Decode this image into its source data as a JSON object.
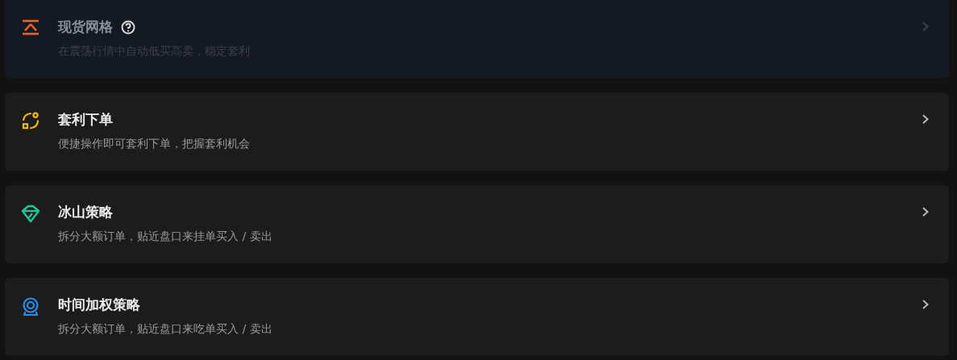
{
  "strategies": [
    {
      "kind": "grid",
      "title": "现货网格",
      "help": true,
      "disabled": true,
      "description": "在震荡行情中自动低买高卖，稳定套利"
    },
    {
      "kind": "arbitrage",
      "title": "套利下单",
      "help": false,
      "disabled": false,
      "description": "便捷操作即可套利下单，把握套利机会"
    },
    {
      "kind": "iceberg",
      "title": "冰山策略",
      "help": false,
      "disabled": false,
      "description": "拆分大额订单，贴近盘口来挂单买入 / 卖出"
    },
    {
      "kind": "twap",
      "title": "时间加权策略",
      "help": false,
      "disabled": false,
      "description": "拆分大额订单，贴近盘口来吃单买入 / 卖出"
    }
  ]
}
